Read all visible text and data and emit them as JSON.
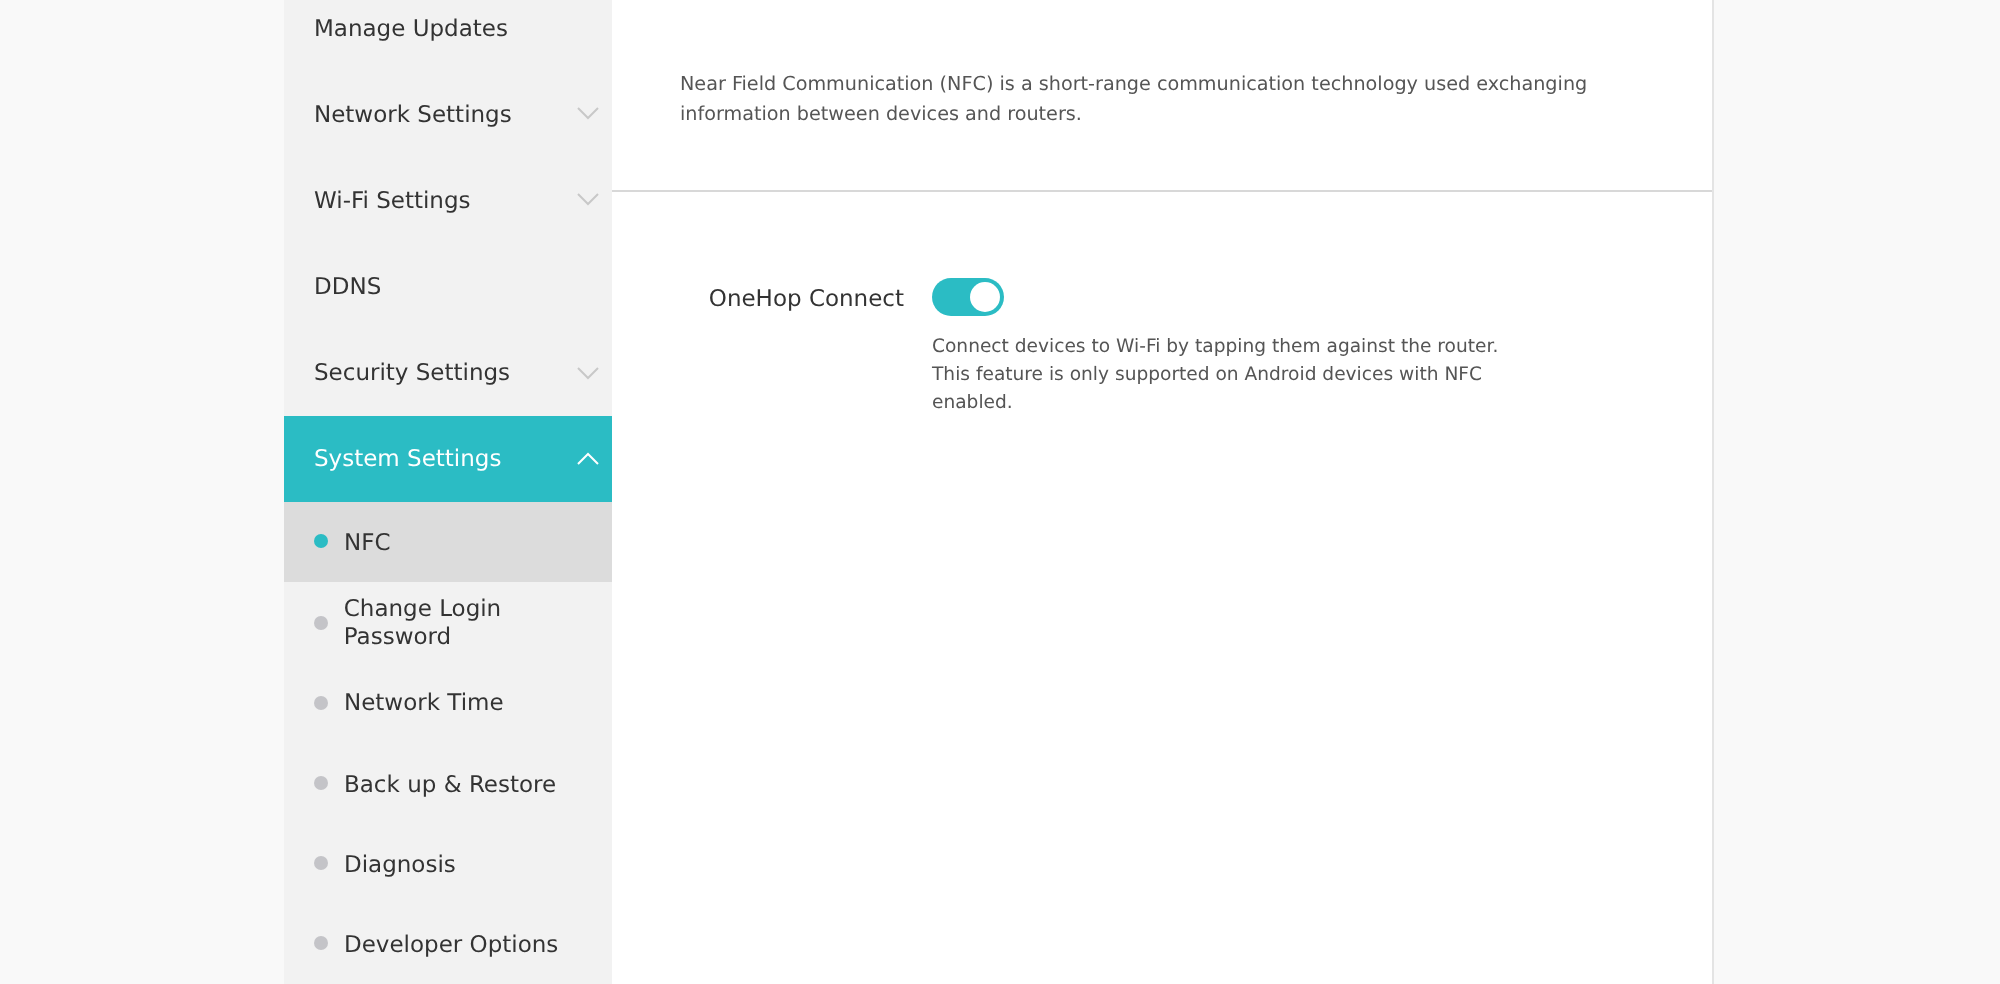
{
  "sidebar": {
    "items": [
      {
        "kind": "link",
        "label": "Manage Updates",
        "selected": false
      },
      {
        "kind": "group",
        "label": "Network Settings",
        "selected": false,
        "expanded": false
      },
      {
        "kind": "group",
        "label": "Wi-Fi Settings",
        "selected": false,
        "expanded": false
      },
      {
        "kind": "link",
        "label": "DDNS",
        "selected": false
      },
      {
        "kind": "group",
        "label": "Security Settings",
        "selected": false,
        "expanded": false
      },
      {
        "kind": "group",
        "label": "System Settings",
        "selected": true,
        "expanded": true,
        "children": [
          {
            "label": "NFC",
            "selected": true
          },
          {
            "label": "Change Login Password",
            "selected": false
          },
          {
            "label": "Network Time",
            "selected": false
          },
          {
            "label": "Back up & Restore",
            "selected": false
          },
          {
            "label": "Diagnosis",
            "selected": false
          },
          {
            "label": "Developer Options",
            "selected": false
          }
        ]
      }
    ]
  },
  "content": {
    "description": "Near Field Communication (NFC) is a short-range communication technology used exchanging information between devices and routers.",
    "settings": [
      {
        "label": "OneHop Connect",
        "on": true,
        "help": "Connect devices to Wi-Fi by tapping them against the router. This feature is only supported on Android devices with NFC enabled."
      }
    ]
  }
}
